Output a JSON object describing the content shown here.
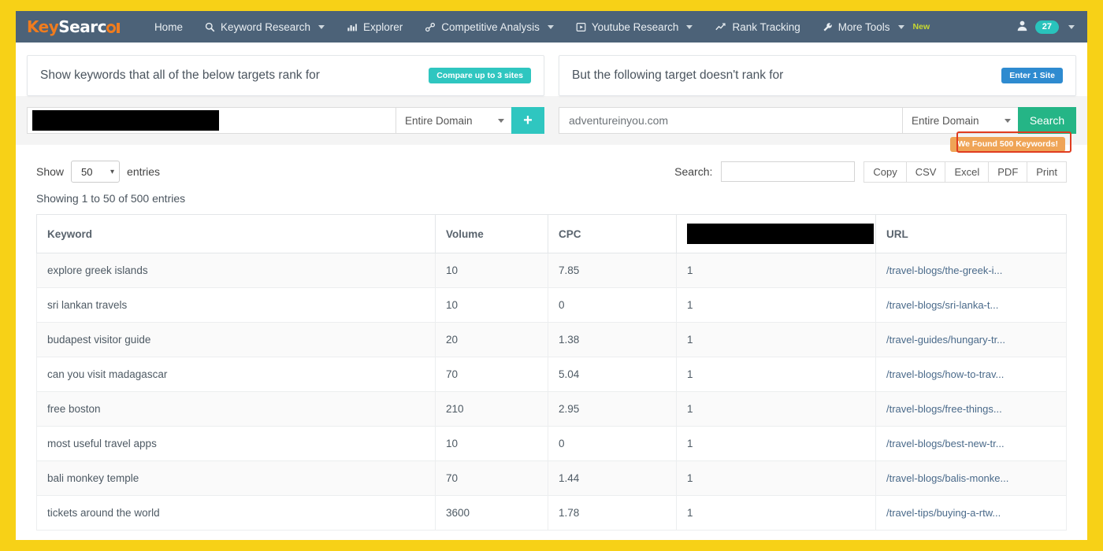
{
  "theme": {
    "frame": "#F7D117",
    "navbar": "#4C6278",
    "teal": "#2FC6C0",
    "green": "#25B586",
    "blue": "#2E8BD0",
    "orange": "#EFA456",
    "alert_outline": "#E03C20"
  },
  "navbar": {
    "logo": {
      "part1": "Key",
      "part2": "Searc",
      "part3": "h",
      "icon": "keysearch-logo"
    },
    "items": [
      {
        "label": "Home",
        "icon": null,
        "caret": false
      },
      {
        "label": "Keyword Research",
        "icon": "search-icon",
        "caret": true
      },
      {
        "label": "Explorer",
        "icon": "bar-chart-icon",
        "caret": false
      },
      {
        "label": "Competitive Analysis",
        "icon": "link-icon",
        "caret": true
      },
      {
        "label": "Youtube Research",
        "icon": "video-icon",
        "caret": true
      },
      {
        "label": "Rank Tracking",
        "icon": "line-chart-icon",
        "caret": false
      },
      {
        "label": "More Tools",
        "icon": "wrench-icon",
        "caret": true,
        "badge": "New"
      }
    ],
    "account": {
      "icon": "user-icon",
      "count": "27",
      "caret": true
    }
  },
  "panels": {
    "left": {
      "title": "Show keywords that all of the below targets rank for",
      "pill": "Compare up to 3 sites"
    },
    "right": {
      "title": "But the following target doesn't rank for",
      "pill": "Enter 1 Site"
    }
  },
  "search": {
    "left": {
      "value": "",
      "redacted": true,
      "scope": "Entire Domain",
      "add_button": "+"
    },
    "right": {
      "value": "adventureinyou.com",
      "placeholder": "",
      "scope": "Entire Domain",
      "search_button": "Search"
    }
  },
  "table_controls": {
    "show_label": "Show",
    "entries_label": "entries",
    "page_size": "50",
    "search_label": "Search:",
    "search_value": "",
    "export_buttons": [
      "Copy",
      "CSV",
      "Excel",
      "PDF",
      "Print"
    ],
    "found_badge": "We Found 500 Keywords!",
    "showing": "Showing 1 to 50 of 500 entries"
  },
  "table": {
    "columns": [
      "Keyword",
      "Volume",
      "CPC",
      "",
      "URL"
    ],
    "column_redacted_index": 3,
    "rows": [
      {
        "keyword": "explore greek islands",
        "volume": "10",
        "cpc": "7.85",
        "col4": "1",
        "url": "/travel-blogs/the-greek-i..."
      },
      {
        "keyword": "sri lankan travels",
        "volume": "10",
        "cpc": "0",
        "col4": "1",
        "url": "/travel-blogs/sri-lanka-t..."
      },
      {
        "keyword": "budapest visitor guide",
        "volume": "20",
        "cpc": "1.38",
        "col4": "1",
        "url": "/travel-guides/hungary-tr..."
      },
      {
        "keyword": "can you visit madagascar",
        "volume": "70",
        "cpc": "5.04",
        "col4": "1",
        "url": "/travel-blogs/how-to-trav..."
      },
      {
        "keyword": "free boston",
        "volume": "210",
        "cpc": "2.95",
        "col4": "1",
        "url": "/travel-blogs/free-things..."
      },
      {
        "keyword": "most useful travel apps",
        "volume": "10",
        "cpc": "0",
        "col4": "1",
        "url": "/travel-blogs/best-new-tr..."
      },
      {
        "keyword": "bali monkey temple",
        "volume": "70",
        "cpc": "1.44",
        "col4": "1",
        "url": "/travel-blogs/balis-monke..."
      },
      {
        "keyword": "tickets around the world",
        "volume": "3600",
        "cpc": "1.78",
        "col4": "1",
        "url": "/travel-tips/buying-a-rtw..."
      }
    ]
  }
}
